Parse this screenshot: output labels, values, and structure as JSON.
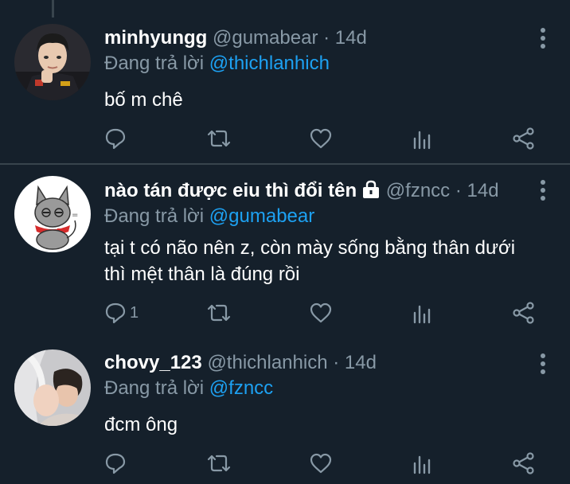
{
  "tweets": [
    {
      "name": "minhyungg",
      "handle": "@gumabear",
      "dot": "·",
      "time": "14d",
      "reply_prefix": "Đang trả lời ",
      "reply_mention": "@thichlanhich",
      "text": "bố m chê",
      "reply_count": ""
    },
    {
      "name": "nào tán được eiu thì đổi tên",
      "handle": "@fzncc",
      "dot": "·",
      "time": "14d",
      "reply_prefix": "Đang trả lời ",
      "reply_mention": "@gumabear",
      "text_line1": "tại t có não nên z, còn mày sống bằng thân dưới",
      "text_line2": "thì mệt thân là đúng rồi",
      "reply_count": "1",
      "protected_icon": "lock-icon"
    },
    {
      "name": "chovy_123",
      "handle": "@thichlanhich",
      "dot": "·",
      "time": "14d",
      "reply_prefix": "Đang trả lời ",
      "reply_mention": "@fzncc",
      "text": "đcm ông",
      "reply_count": ""
    }
  ],
  "icons": [
    "reply-icon",
    "retweet-icon",
    "like-icon",
    "analytics-icon",
    "share-icon",
    "more-icon"
  ],
  "colors": {
    "background": "#15202b",
    "secondary_text": "#8899a6",
    "link": "#1da1f2",
    "divider": "#38444d"
  }
}
